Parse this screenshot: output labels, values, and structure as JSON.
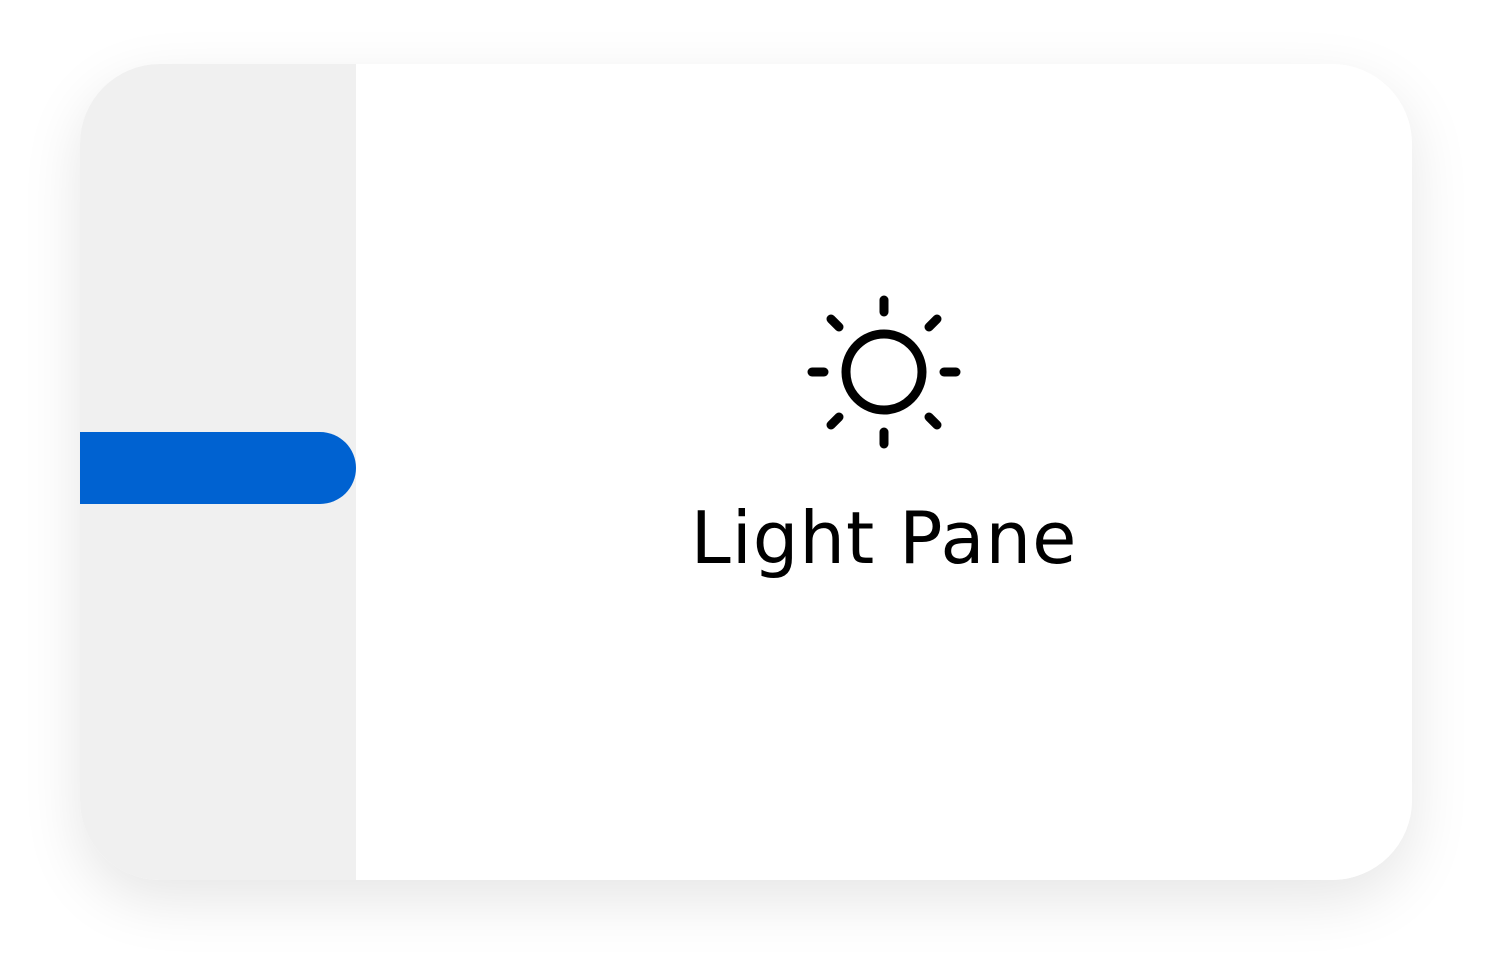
{
  "pane": {
    "title": "Light Pane",
    "icon": "sun-icon"
  },
  "colors": {
    "accent": "#0062d1",
    "sidebar_bg": "#f0f0f0",
    "pane_bg": "#ffffff",
    "text": "#000000"
  }
}
